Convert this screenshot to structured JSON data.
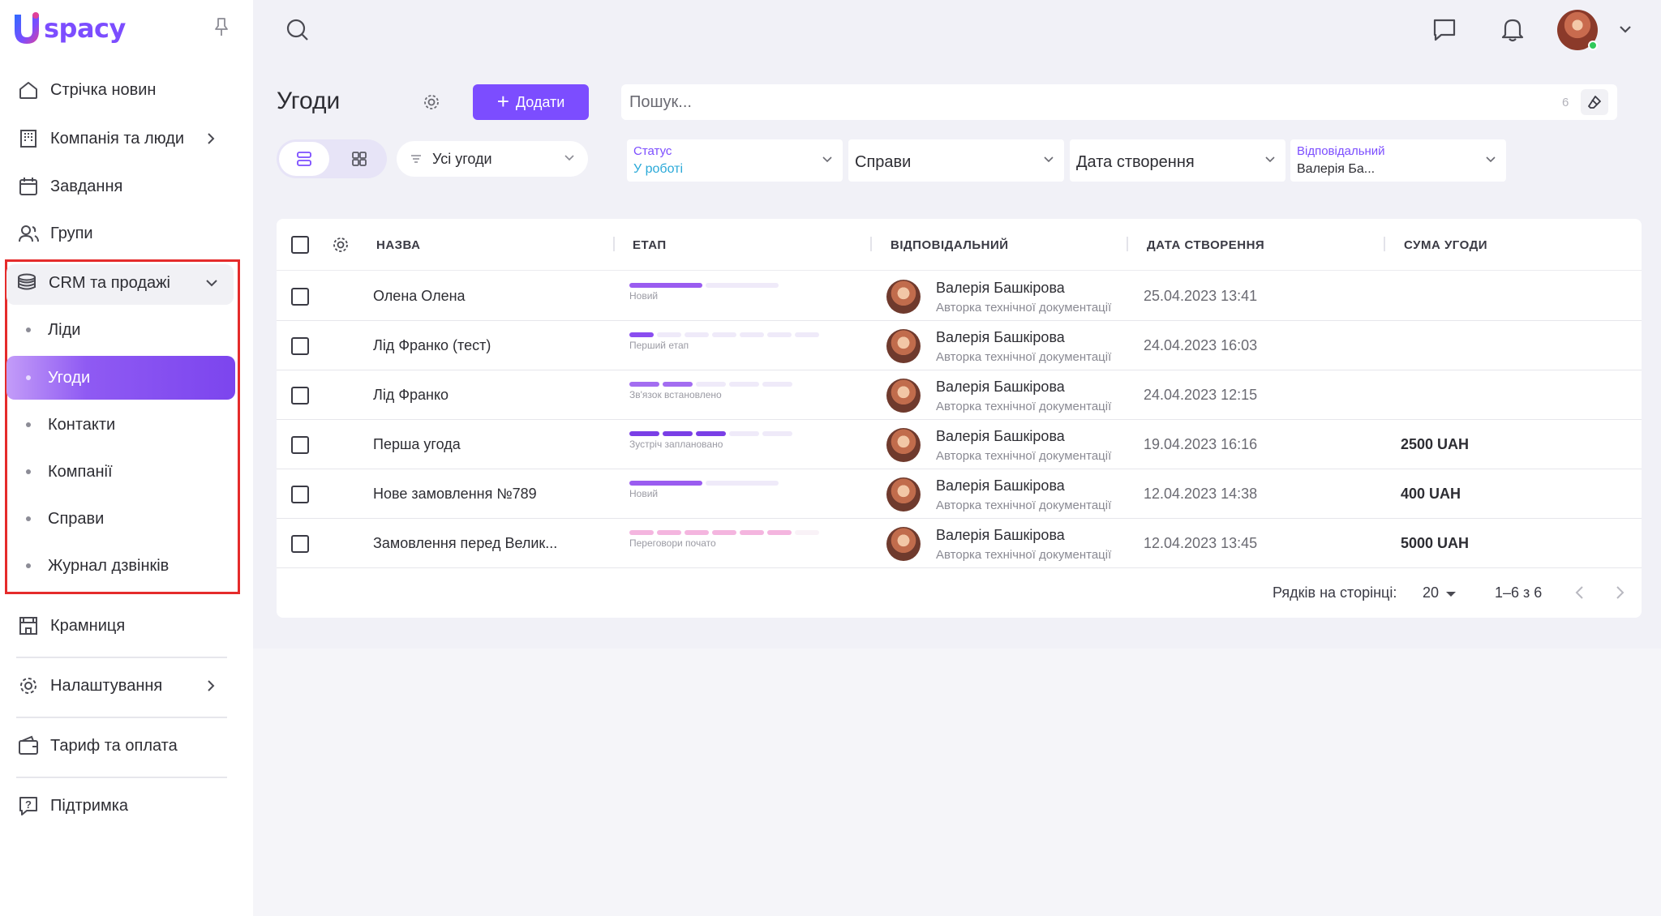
{
  "brand": {
    "logo_text": "spacy",
    "accent": "#7c4dff"
  },
  "sidebar": {
    "items": [
      {
        "label": "Стрічка новин",
        "icon": "home-icon"
      },
      {
        "label": "Компанія та люди",
        "icon": "building-icon"
      },
      {
        "label": "Завдання",
        "icon": "calendar-icon"
      },
      {
        "label": "Групи",
        "icon": "users-icon"
      },
      {
        "label": "CRM та продажі",
        "icon": "coins-icon"
      },
      {
        "label": "Крамниця",
        "icon": "store-icon"
      },
      {
        "label": "Налаштування",
        "icon": "gear-icon"
      },
      {
        "label": "Тариф та оплата",
        "icon": "wallet-icon"
      },
      {
        "label": "Підтримка",
        "icon": "help-icon"
      }
    ],
    "crm_sub": [
      {
        "label": "Ліди"
      },
      {
        "label": "Угоди",
        "active": true
      },
      {
        "label": "Контакти"
      },
      {
        "label": "Компанії"
      },
      {
        "label": "Справи"
      },
      {
        "label": "Журнал дзвінків"
      }
    ]
  },
  "page": {
    "title": "Угоди",
    "add_label": "Додати",
    "search_placeholder": "Пошук...",
    "search_count": "6",
    "deals_filter": "Усі угоди",
    "filters": [
      {
        "label": "Статус",
        "value": "У роботі"
      },
      {
        "label": "",
        "value": "Справи"
      },
      {
        "label": "",
        "value": "Дата створення"
      },
      {
        "label": "Відповідальний",
        "value": "Валерія Ба..."
      }
    ]
  },
  "table": {
    "columns": [
      "НАЗВА",
      "ЕТАП",
      "ВІДПОВІДАЛЬНИЙ",
      "ДАТА СТВОРЕННЯ",
      "СУМА УГОДИ"
    ],
    "rows": [
      {
        "name": "Олена Олена",
        "stage": "Новий",
        "responsible": "Валерія Башкірова",
        "role": "Авторка технічної документації",
        "date": "25.04.2023 13:41",
        "sum": ""
      },
      {
        "name": "Лід Франко (тест)",
        "stage": "Перший етап",
        "responsible": "Валерія Башкірова",
        "role": "Авторка технічної документації",
        "date": "24.04.2023 16:03",
        "sum": ""
      },
      {
        "name": "Лід Франко",
        "stage": "Зв'язок встановлено",
        "responsible": "Валерія Башкірова",
        "role": "Авторка технічної документації",
        "date": "24.04.2023 12:15",
        "sum": ""
      },
      {
        "name": "Перша угода",
        "stage": "Зустріч заплановано",
        "responsible": "Валерія Башкірова",
        "role": "Авторка технічної документації",
        "date": "19.04.2023 16:16",
        "sum": "2500 UAH"
      },
      {
        "name": "Нове замовлення №789",
        "stage": "Новий",
        "responsible": "Валерія Башкірова",
        "role": "Авторка технічної документації",
        "date": "12.04.2023 14:38",
        "sum": "400 UAH"
      },
      {
        "name": "Замовлення перед Велик...",
        "stage": "Переговори почато",
        "responsible": "Валерія Башкірова",
        "role": "Авторка технічної документації",
        "date": "12.04.2023 13:45",
        "sum": "5000 UAH"
      }
    ]
  },
  "pagination": {
    "rows_label": "Рядків на сторінці:",
    "rows_value": "20",
    "range": "1–6 з 6"
  }
}
